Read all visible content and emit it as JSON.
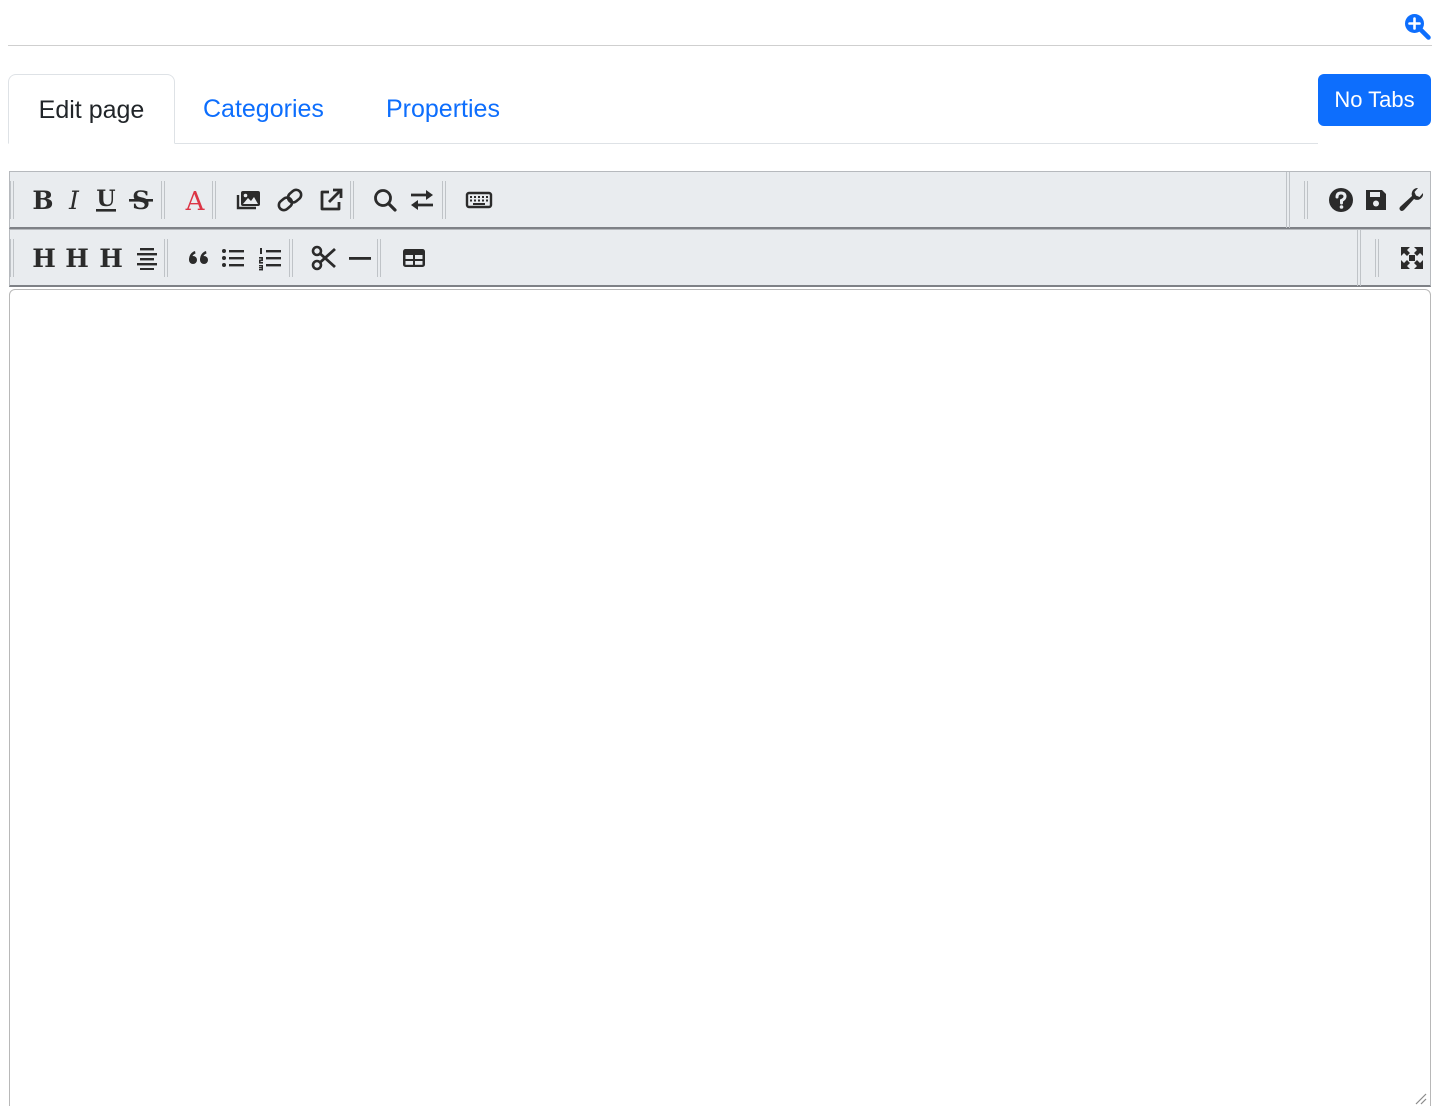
{
  "header": {
    "zoom_icon": "magnifier-plus-icon"
  },
  "tabs": [
    {
      "label": "Edit page",
      "active": true
    },
    {
      "label": "Categories",
      "active": false
    },
    {
      "label": "Properties",
      "active": false
    }
  ],
  "no_tabs_button": {
    "label": "No Tabs",
    "color": "#0d6efd"
  },
  "toolbar_row1": {
    "left": [
      "bold-icon",
      "italic-icon",
      "underline-icon",
      "strikethrough-icon",
      "text-color-icon",
      "image-icon",
      "link-icon",
      "external-link-icon",
      "find-icon",
      "replace-icon",
      "keyboard-icon"
    ],
    "right": [
      "help-icon",
      "save-icon",
      "settings-wrench-icon"
    ]
  },
  "toolbar_row2": {
    "left": [
      "heading1-icon",
      "heading2-icon",
      "heading3-icon",
      "align-center-icon",
      "blockquote-icon",
      "unordered-list-icon",
      "ordered-list-icon",
      "cut-icon",
      "horizontal-rule-icon",
      "table-icon"
    ],
    "right": [
      "fullscreen-icon"
    ]
  },
  "letters": {
    "bold": "B",
    "italic": "I",
    "underline": "U",
    "strike": "S",
    "color": "A",
    "heading": "H"
  },
  "colors": {
    "accent": "#0d6efd",
    "text_color_icon": "#dc3545",
    "toolbar_bg": "#e9ecef"
  },
  "editor": {
    "value": "",
    "placeholder": ""
  }
}
